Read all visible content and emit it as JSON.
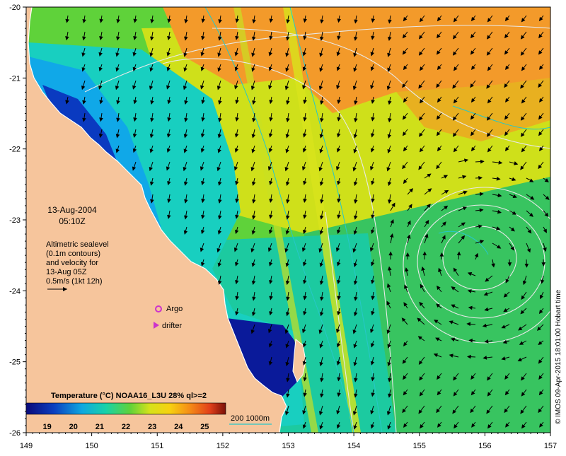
{
  "map": {
    "date": "13-Aug-2004",
    "time": "05:10Z",
    "annotation_lines": [
      "Altimetric sealevel",
      "(0.1m contours)",
      "and velocity for",
      "13-Aug 05Z",
      "0.5m/s (1kt 12h)"
    ],
    "legend": {
      "argo": "Argo",
      "drifter": "drifter"
    },
    "credit": "© IMOS 09-Apr-2015 18:01:00 Hobart time",
    "colorbar": {
      "title": "Temperature (°C) NOAA16_L3U 28% ql>=2",
      "ticks": [
        "19",
        "20",
        "21",
        "22",
        "23",
        "24",
        "25"
      ],
      "range": [
        18.2,
        25.8
      ]
    },
    "bathymetry_label": "200  1000m",
    "lon_ticks": [
      "149",
      "150",
      "151",
      "152",
      "153",
      "154",
      "155",
      "156",
      "157"
    ],
    "lat_ticks": [
      "-20",
      "-21",
      "-22",
      "-23",
      "-24",
      "-25",
      "-26"
    ],
    "lon_range": [
      149,
      157
    ],
    "lat_range": [
      -20,
      -26
    ],
    "colors": {
      "land": "#f6c59c",
      "warm": "#f08a2a",
      "mid": "#a6d530",
      "cool": "#16c9b0",
      "cold": "#0a2a9e",
      "argo": "#cc33cc",
      "drifter": "#cc33cc",
      "contour": "#e8e8e8",
      "isobath": "#26c8c8"
    }
  }
}
